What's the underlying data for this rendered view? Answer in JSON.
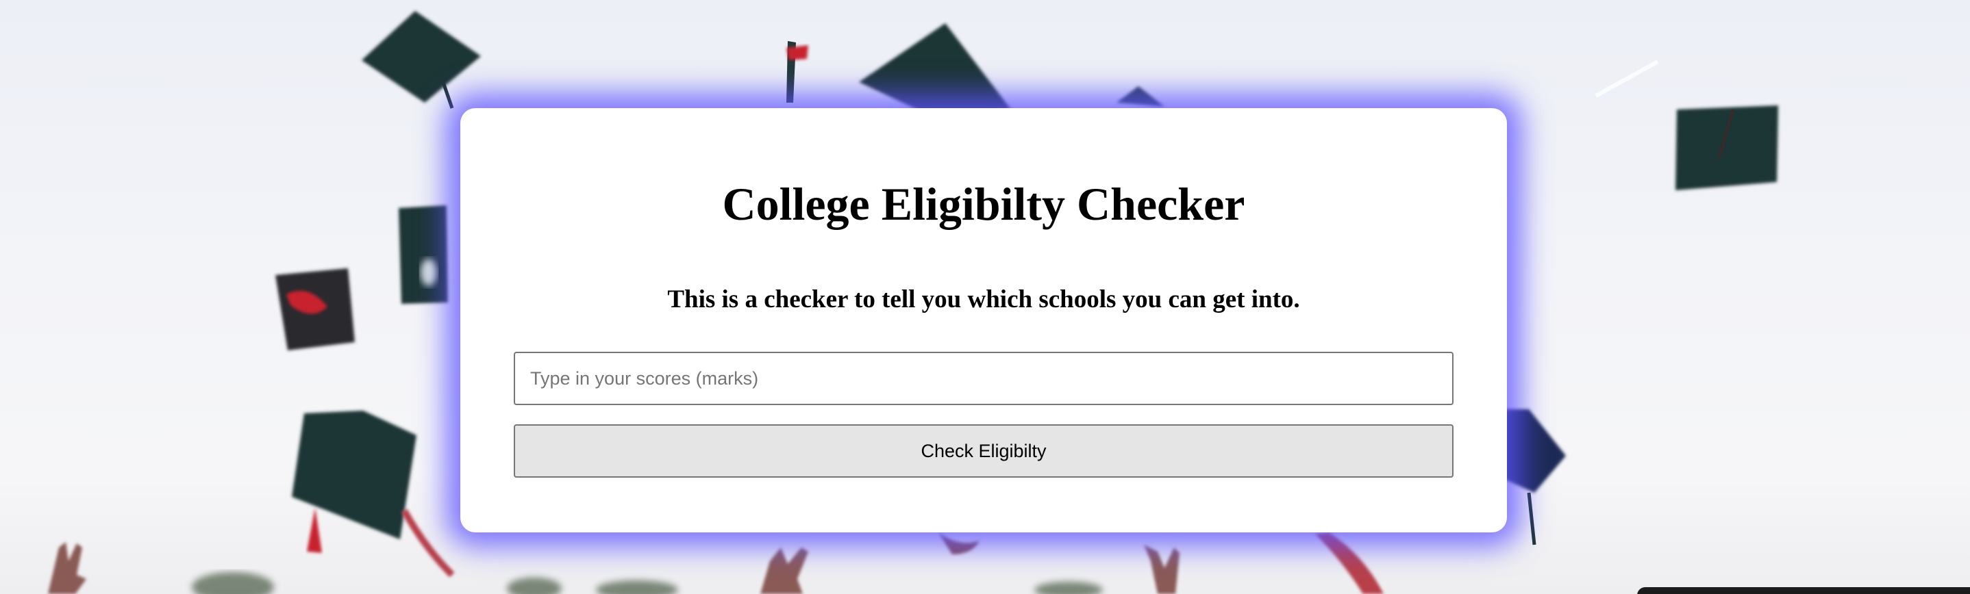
{
  "card": {
    "title": "College Eligibilty Checker",
    "subtitle": "This is a checker to tell you which schools you can get into."
  },
  "scores_input": {
    "value": "",
    "placeholder": "Type in your scores (marks)"
  },
  "check_button": {
    "label": "Check Eligibilty"
  },
  "colors": {
    "card_glow": "#5c52ff",
    "cap": "#1e3435",
    "tassel": "#c8202f",
    "sky": "#eef0f6"
  },
  "icons": {
    "background": "graduation-caps-photo"
  }
}
